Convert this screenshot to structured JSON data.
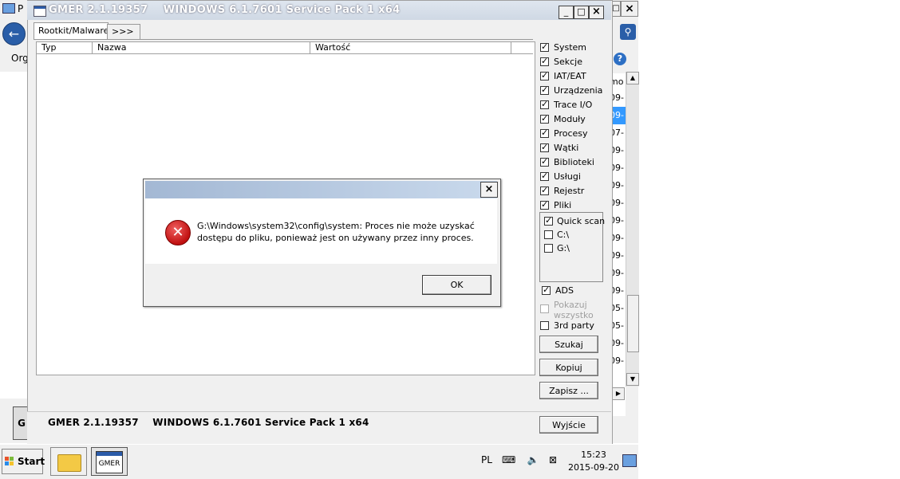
{
  "background_window": {
    "title_fragment": "P",
    "toolbar_fragment": "Org",
    "column_fragment": "mo",
    "date_fragments": [
      "09-",
      "09-",
      "07-",
      "09-",
      "09-",
      "09-",
      "09-",
      "09-",
      "09-",
      "09-",
      "09-",
      "09-",
      "05-",
      "05-",
      "09-",
      "09-"
    ],
    "selected_index": 1,
    "taskbar_icon_label": "G"
  },
  "gmer": {
    "title": "GMER 2.1.19357    WINDOWS 6.1.7601 Service Pack 1 x64",
    "window_buttons": {
      "minimize": "_",
      "maximize": "□",
      "close": "×"
    },
    "tabs": [
      {
        "label": "Rootkit/Malware",
        "active": true
      },
      {
        "label": ">>>",
        "active": false
      }
    ],
    "columns": [
      "Typ",
      "Nazwa",
      "Wartość"
    ],
    "options": [
      {
        "label": "System",
        "checked": true
      },
      {
        "label": "Sekcje",
        "checked": true
      },
      {
        "label": "IAT/EAT",
        "checked": true
      },
      {
        "label": "Urządzenia",
        "checked": true
      },
      {
        "label": "Trace I/O",
        "checked": true
      },
      {
        "label": "Moduły",
        "checked": true
      },
      {
        "label": "Procesy",
        "checked": true
      },
      {
        "label": "Wątki",
        "checked": true
      },
      {
        "label": "Biblioteki",
        "checked": true
      },
      {
        "label": "Usługi",
        "checked": true
      },
      {
        "label": "Rejestr",
        "checked": true
      },
      {
        "label": "Pliki",
        "checked": true
      }
    ],
    "scan_targets": [
      {
        "label": "Quick scan",
        "checked": true
      },
      {
        "label": "C:\\",
        "checked": false
      },
      {
        "label": "G:\\",
        "checked": false
      }
    ],
    "ads": {
      "label": "ADS",
      "checked": true
    },
    "show_all": {
      "line1": "Pokazuj",
      "line2": "wszystko",
      "checked": false,
      "disabled": true
    },
    "third_party": {
      "label": "3rd party",
      "checked": false
    },
    "buttons": {
      "scan": "Szukaj",
      "copy": "Kopiuj",
      "save": "Zapisz ...",
      "exit": "Wyjście"
    },
    "status": "GMER 2.1.19357    WINDOWS 6.1.7601 Service Pack 1 x64"
  },
  "dialog": {
    "close": "×",
    "icon": "error-icon",
    "message_line1": "G:\\Windows\\system32\\config\\system: Proces nie może uzyskać",
    "message_line2": "dostępu do pliku, ponieważ jest on używany przez inny proces.",
    "ok_label": "OK"
  },
  "taskbar": {
    "start_label": "Start",
    "gmer_app_label": "GMER",
    "language": "PL",
    "time": "15:23",
    "date": "2015-09-20"
  },
  "colors": {
    "dialog_title_gradient_start": "#a3b8d4",
    "dialog_title_gradient_end": "#c9d9ec",
    "error_red": "#c01010",
    "selection_blue": "#3399ff"
  }
}
